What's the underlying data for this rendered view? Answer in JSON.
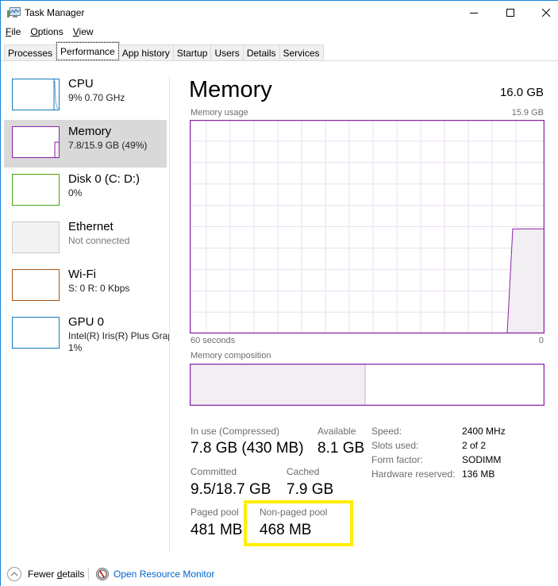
{
  "window": {
    "title": "Task Manager",
    "controls": {
      "minimize": "minimize",
      "maximize": "maximize",
      "close": "close"
    }
  },
  "menu": [
    {
      "label_underline": "F",
      "label_rest": "ile"
    },
    {
      "label_underline": "O",
      "label_rest": "ptions"
    },
    {
      "label_underline": "V",
      "label_rest": "iew"
    }
  ],
  "tabs": [
    {
      "label": "Processes",
      "active": false
    },
    {
      "label": "Performance",
      "active": true
    },
    {
      "label": "App history",
      "active": false
    },
    {
      "label": "Startup",
      "active": false
    },
    {
      "label": "Users",
      "active": false
    },
    {
      "label": "Details",
      "active": false
    },
    {
      "label": "Services",
      "active": false
    }
  ],
  "sidebar": {
    "items": [
      {
        "name": "CPU",
        "sub": "9% 0.70 GHz",
        "color": "#1979ba",
        "selected": false
      },
      {
        "name": "Memory",
        "sub": "7.8/15.9 GB (49%)",
        "color": "#8b25a8",
        "selected": true
      },
      {
        "name": "Disk 0 (C: D:)",
        "sub": "0%",
        "color": "#4aa00f",
        "selected": false
      },
      {
        "name": "Ethernet",
        "sub": "Not connected",
        "color": "#a0a0a0",
        "selected": false
      },
      {
        "name": "Wi-Fi",
        "sub": "S: 0 R: 0 Kbps",
        "color": "#a75413",
        "selected": false
      },
      {
        "name": "GPU 0",
        "sub": "Intel(R) Iris(R) Plus Graphics",
        "sub2": "1%",
        "color": "#1979ba",
        "selected": false
      }
    ]
  },
  "main": {
    "title": "Memory",
    "total": "16.0 GB",
    "usage_label": "Memory usage",
    "usage_max": "15.9 GB",
    "time_left": "60 seconds",
    "time_right": "0",
    "composition_label": "Memory composition",
    "accent": "#8b25a8",
    "grid_color": "#ecdcf0",
    "fill_color": "#f2eff3",
    "usage_current_fraction": 0.49,
    "composition_in_use_fraction": 0.49
  },
  "stats": {
    "in_use_label": "In use (Compressed)",
    "in_use_value": "7.8 GB (430 MB)",
    "available_label": "Available",
    "available_value": "8.1 GB",
    "committed_label": "Committed",
    "committed_value": "9.5/18.7 GB",
    "cached_label": "Cached",
    "cached_value": "7.9 GB",
    "paged_label": "Paged pool",
    "paged_value": "481 MB",
    "nonpaged_label": "Non-paged pool",
    "nonpaged_value": "468 MB"
  },
  "details": [
    {
      "key": "Speed:",
      "value": "2400 MHz"
    },
    {
      "key": "Slots used:",
      "value": "2 of 2"
    },
    {
      "key": "Form factor:",
      "value": "SODIMM"
    },
    {
      "key": "Hardware reserved:",
      "value": "136 MB"
    }
  ],
  "footer": {
    "fewer_underline_pre": "Fewer ",
    "fewer_underline": "d",
    "fewer_post": "etails",
    "resource_monitor": "Open Resource Monitor"
  }
}
